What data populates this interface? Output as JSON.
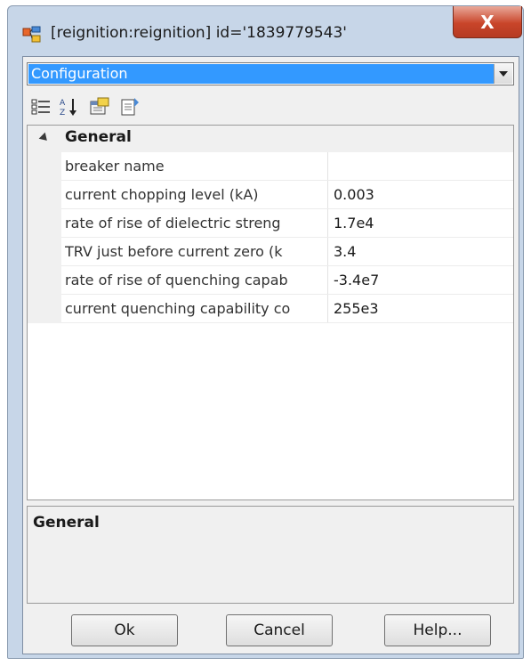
{
  "window": {
    "title": "[reignition:reignition] id='1839779543'",
    "close_glyph": "X",
    "icon": "component-icon"
  },
  "combo": {
    "selected": "Configuration",
    "arrow_icon": "dropdown-arrow-icon"
  },
  "toolbar": {
    "buttons": [
      {
        "icon": "categorized-view-icon"
      },
      {
        "icon": "alphabetical-sort-icon"
      },
      {
        "icon": "property-pages-icon"
      },
      {
        "icon": "events-icon"
      }
    ]
  },
  "grid": {
    "category": "General",
    "rows": [
      {
        "name": "breaker name",
        "value": ""
      },
      {
        "name": "current chopping level (kA)",
        "value": "0.003"
      },
      {
        "name": "rate of rise  of dielectric  streng",
        "value": "1.7e4"
      },
      {
        "name": "TRV just before current zero (k",
        "value": "3.4"
      },
      {
        "name": "rate of rise of quenching capab",
        "value": "-3.4e7"
      },
      {
        "name": "current quenching capability co",
        "value": "255e3"
      }
    ]
  },
  "help": {
    "title": "General"
  },
  "buttons": {
    "ok": "Ok",
    "cancel": "Cancel",
    "help": "Help..."
  },
  "colors": {
    "selection": "#3399ff",
    "close_button": "#c9452a",
    "frame": "#c7d6e8"
  }
}
